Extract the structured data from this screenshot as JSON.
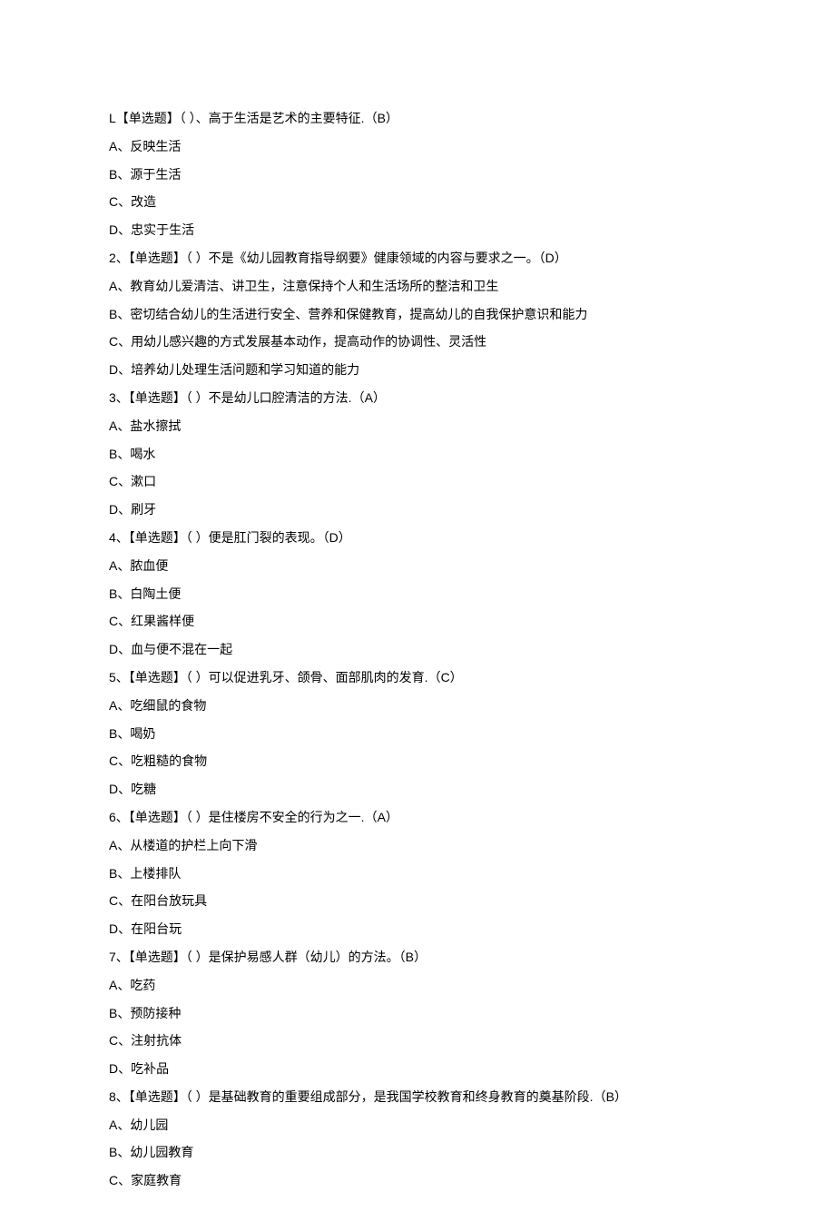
{
  "questions": [
    {
      "num": "L",
      "type": "【单选题】",
      "stem": "（ ）、高于生活是艺术的主要特征.（B）",
      "options": [
        {
          "letter": "A",
          "text": "反映生活"
        },
        {
          "letter": "B",
          "text": "源于生活"
        },
        {
          "letter": "C",
          "text": "改造"
        },
        {
          "letter": "D",
          "text": "忠实于生活"
        }
      ]
    },
    {
      "num": "2、",
      "type": "【单选题】",
      "stem": "（ ）不是《幼儿园教育指导纲要》健康领域的内容与要求之一。（D）",
      "options": [
        {
          "letter": "A",
          "text": "教育幼儿爱清洁、讲卫生，注意保持个人和生活场所的整洁和卫生"
        },
        {
          "letter": "B",
          "text": "密切结合幼儿的生活进行安全、营养和保健教育，提高幼儿的自我保护意识和能力"
        },
        {
          "letter": "C",
          "text": "用幼儿感兴趣的方式发展基本动作，提高动作的协调性、灵活性"
        },
        {
          "letter": "D",
          "text": "培养幼儿处理生活问题和学习知道的能力"
        }
      ]
    },
    {
      "num": "3、",
      "type": "【单选题】",
      "stem": "（ ）不是幼儿口腔清洁的方法.（A）",
      "options": [
        {
          "letter": "A",
          "text": "盐水擦拭"
        },
        {
          "letter": "B",
          "text": "喝水"
        },
        {
          "letter": "C",
          "text": "漱口"
        },
        {
          "letter": "D",
          "text": "刷牙"
        }
      ]
    },
    {
      "num": "4、",
      "type": "【单选题】",
      "stem": "（ ）便是肛门裂的表现。（D）",
      "options": [
        {
          "letter": "A",
          "text": "脓血便"
        },
        {
          "letter": "B",
          "text": "白陶土便"
        },
        {
          "letter": "C",
          "text": "红果酱样便"
        },
        {
          "letter": "D",
          "text": "血与便不混在一起"
        }
      ]
    },
    {
      "num": "5、",
      "type": "【单选题】",
      "stem": "（ ）可以促进乳牙、颌骨、面部肌肉的发育.（C）",
      "options": [
        {
          "letter": "A",
          "text": "吃细鼠的食物"
        },
        {
          "letter": "B",
          "text": "喝奶"
        },
        {
          "letter": "C",
          "text": "吃粗糙的食物"
        },
        {
          "letter": "D",
          "text": "吃糖"
        }
      ]
    },
    {
      "num": "6、",
      "type": "【单选题】",
      "stem": "（ ）是住楼房不安全的行为之一.（A）",
      "options": [
        {
          "letter": "A",
          "text": "从楼道的护栏上向下滑"
        },
        {
          "letter": "B",
          "text": "上楼排队"
        },
        {
          "letter": "C",
          "text": "在阳台放玩具"
        },
        {
          "letter": "D",
          "text": "在阳台玩"
        }
      ]
    },
    {
      "num": "7、",
      "type": "【单选题】",
      "stem": "（ ）是保护易感人群（幼儿）的方法。（B）",
      "options": [
        {
          "letter": "A",
          "text": "吃药"
        },
        {
          "letter": "B",
          "text": "预防接种"
        },
        {
          "letter": "C",
          "text": "注射抗体"
        },
        {
          "letter": "D",
          "text": "吃补品"
        }
      ]
    },
    {
      "num": "8、",
      "type": "【单选题】",
      "stem": "（ ）是基础教育的重要组成部分，是我国学校教育和终身教育的奠基阶段.（B）",
      "options": [
        {
          "letter": "A",
          "text": "幼儿园"
        },
        {
          "letter": "B",
          "text": "幼儿园教育"
        },
        {
          "letter": "C",
          "text": "家庭教育"
        }
      ]
    }
  ]
}
